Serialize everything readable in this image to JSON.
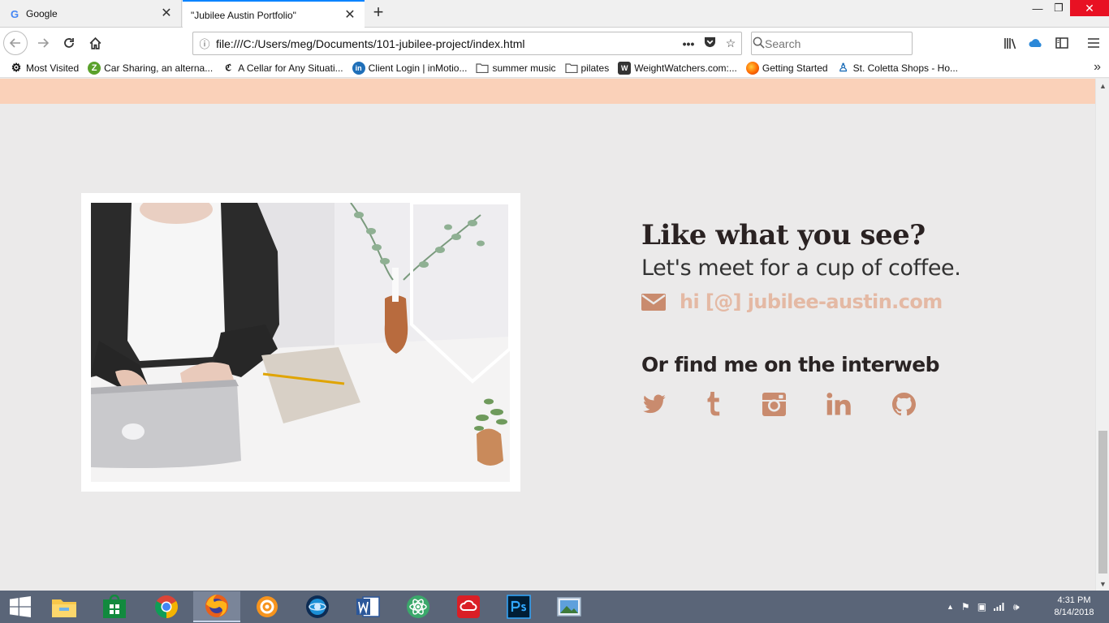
{
  "tabs": [
    {
      "title": "Google",
      "favicon": "google-icon"
    },
    {
      "title": "\"Jubilee Austin Portfolio\"",
      "favicon": "none",
      "active": true
    }
  ],
  "nav": {
    "url": "file:///C:/Users/meg/Documents/101-jubilee-project/index.html",
    "search_placeholder": "Search"
  },
  "bookmarks": [
    {
      "label": "Most Visited",
      "icon": "gear-icon"
    },
    {
      "label": "Car Sharing, an alterna...",
      "icon": "zipcar-icon"
    },
    {
      "label": "A Cellar for Any Situati...",
      "icon": "wine-icon"
    },
    {
      "label": "Client Login | inMotio...",
      "icon": "inmotion-icon"
    },
    {
      "label": "summer music",
      "icon": "folder-icon"
    },
    {
      "label": "pilates",
      "icon": "folder-icon"
    },
    {
      "label": "WeightWatchers.com:...",
      "icon": "ww-icon"
    },
    {
      "label": "Getting Started",
      "icon": "firefox-icon"
    },
    {
      "label": "St. Coletta Shops - Ho...",
      "icon": "person-icon"
    }
  ],
  "page": {
    "heading": "Like what you see?",
    "subheading": "Let's meet for a cup of coffee.",
    "email": "hi [@] jubilee-austin.com",
    "social_heading": "Or find me on the interweb",
    "social_links": [
      "twitter-icon",
      "tumblr-icon",
      "instagram-icon",
      "linkedin-icon",
      "github-icon"
    ],
    "accent_color": "#c98b6e",
    "email_color": "#e4b9a4",
    "header_band_color": "#fad1b9"
  },
  "taskbar": {
    "apps": [
      "file-explorer-icon",
      "store-icon",
      "chrome-icon",
      "firefox-icon",
      "settings-app-icon",
      "globe-app-icon",
      "word-icon",
      "atom-icon",
      "creative-cloud-icon",
      "photoshop-icon",
      "photos-icon"
    ],
    "time": "4:31 PM",
    "date": "8/14/2018"
  }
}
